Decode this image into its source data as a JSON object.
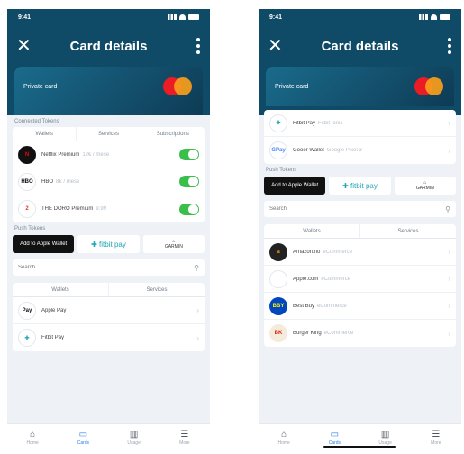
{
  "status": {
    "time": "9:41"
  },
  "header": {
    "title": "Card details"
  },
  "card": {
    "label": "Private card"
  },
  "left": {
    "connected_label": "Connected Tokens",
    "connected_tabs": [
      "Wallets",
      "Services",
      "Subscriptions"
    ],
    "connected_rows": [
      {
        "name": "Netflix Premium",
        "sub": "12€ / mese",
        "logo_text": "N",
        "logo_bg": "#111111",
        "logo_fg": "#e50914"
      },
      {
        "name": "HBO",
        "sub": "8€ / mese",
        "logo_text": "HBO",
        "logo_bg": "#ffffff",
        "logo_fg": "#111111"
      },
      {
        "name": "THE DORO Premium",
        "sub": "9.99",
        "logo_text": "2",
        "logo_bg": "#ffffff",
        "logo_fg": "#e0362c"
      }
    ],
    "push_label": "Push Tokens",
    "search_placeholder": "Search",
    "bottom_tabs": [
      "Wallets",
      "Services"
    ],
    "wallet_rows": [
      {
        "name": "Apple Pay",
        "logo_text": "Pay",
        "logo_bg": "#ffffff",
        "logo_fg": "#111111"
      },
      {
        "name": "Fitbit Pay",
        "logo_text": "✚",
        "logo_bg": "#ffffff",
        "logo_fg": "#22a6b3"
      }
    ]
  },
  "right": {
    "top_rows": [
      {
        "name": "Fitbit Pay",
        "sub": "Fitbit Ionic",
        "logo_text": "✚",
        "logo_bg": "#ffffff",
        "logo_fg": "#22a6b3"
      },
      {
        "name": "Gooer Wallet",
        "sub": "Google Pixel 3",
        "logo_text": "GPay",
        "logo_bg": "#ffffff",
        "logo_fg": "#4285f4"
      }
    ],
    "push_label": "Push Tokens",
    "search_placeholder": "Search",
    "tabs": [
      "Wallets",
      "Services"
    ],
    "service_rows": [
      {
        "name": "Amazon.no",
        "sub": "eCommerce",
        "logo_text": "a",
        "logo_bg": "#222222",
        "logo_fg": "#ff9900"
      },
      {
        "name": "Apple.com",
        "sub": "eCommerce",
        "logo_text": "",
        "logo_bg": "#ffffff",
        "logo_fg": "#111111"
      },
      {
        "name": "Best Buy",
        "sub": "eCommerce",
        "logo_text": "BBY",
        "logo_bg": "#0046be",
        "logo_fg": "#fff200"
      },
      {
        "name": "Burger King",
        "sub": "eCommerce",
        "logo_text": "BK",
        "logo_bg": "#f5ebdc",
        "logo_fg": "#d62300"
      }
    ]
  },
  "push_buttons": {
    "apple": "Add to Apple Wallet",
    "fitbit": "✚ fitbit pay",
    "garmin": "GARMIN"
  },
  "nav": [
    "Home",
    "Cards",
    "Usage",
    "More"
  ],
  "nav_icons": [
    "home-icon",
    "cards-icon",
    "usage-icon",
    "more-icon"
  ],
  "colors": {
    "header": "#0f4a66",
    "toggle_on": "#3bbf4b",
    "active_nav": "#2b7de9"
  }
}
